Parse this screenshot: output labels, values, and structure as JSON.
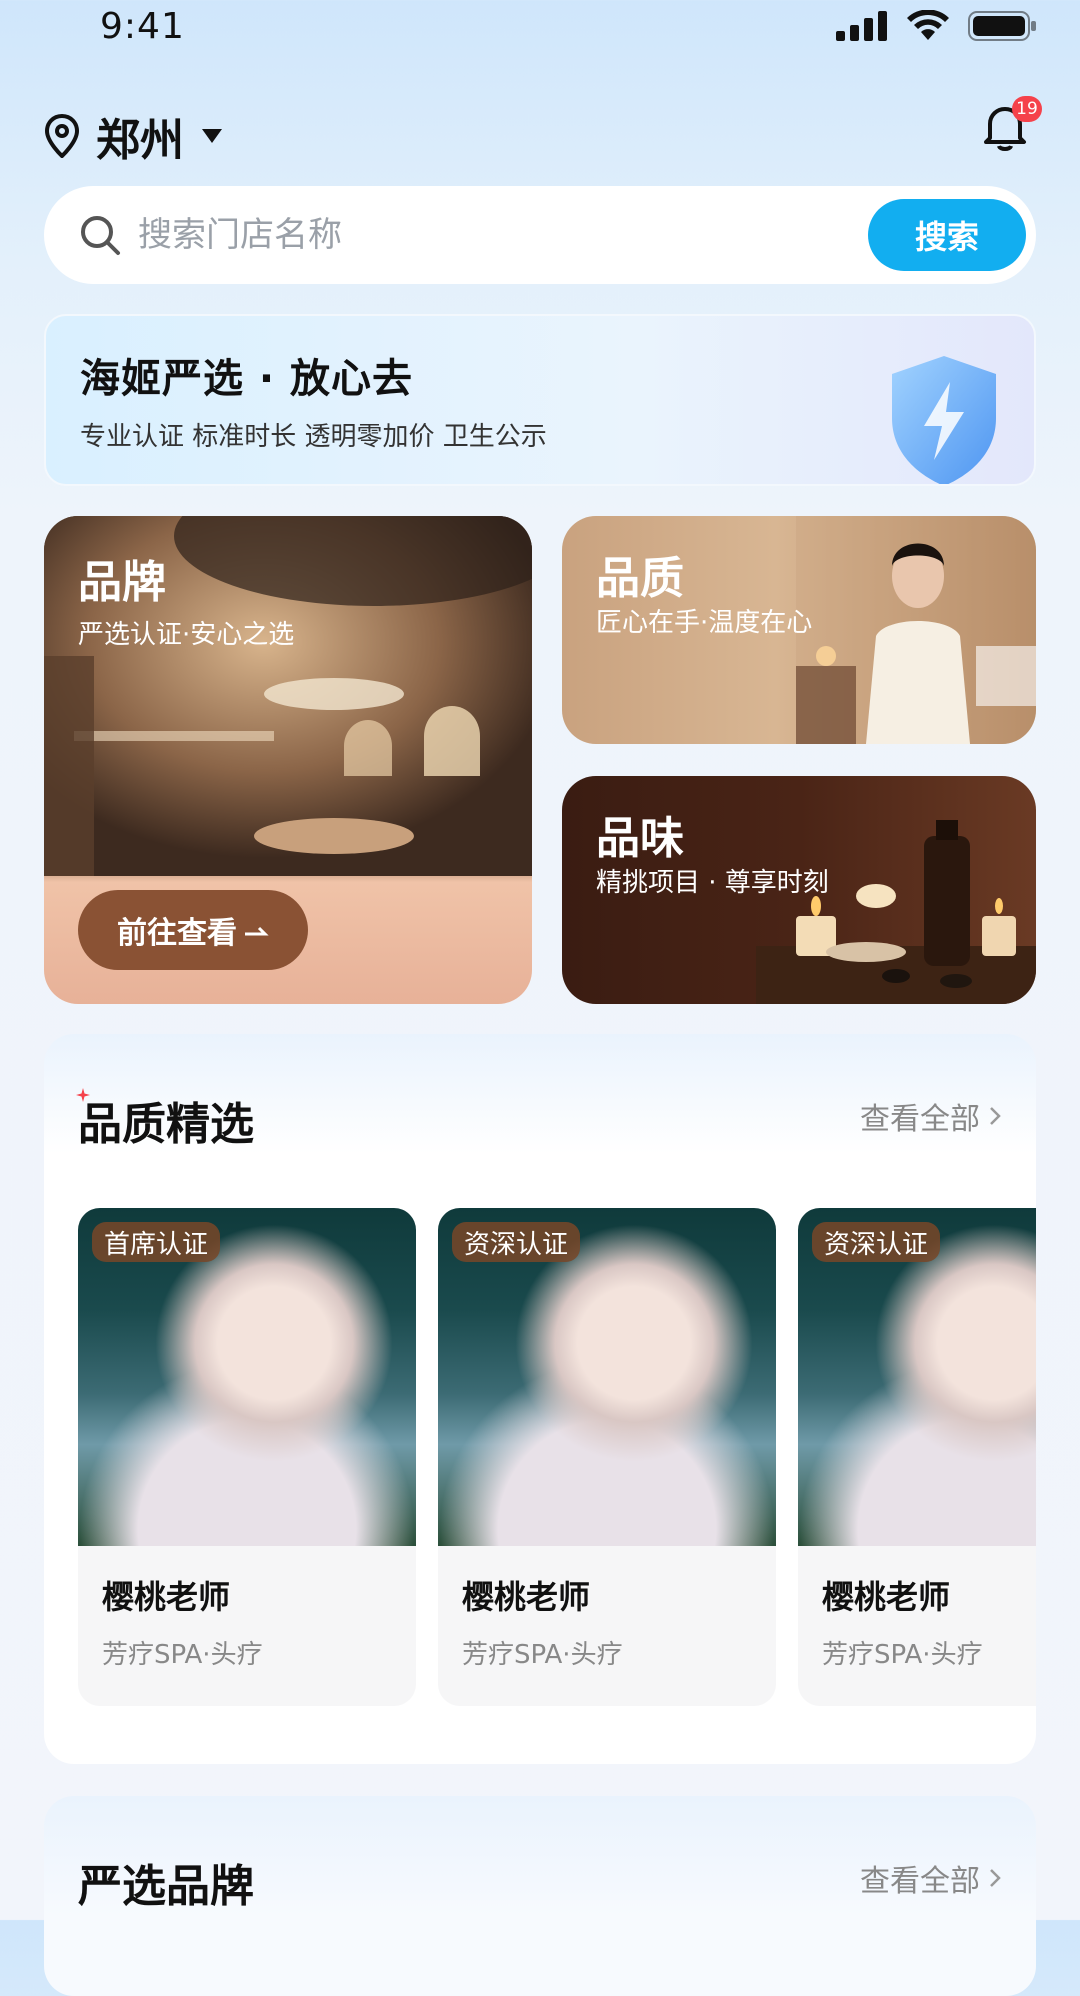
{
  "status_bar": {
    "time": "9:41"
  },
  "header": {
    "city": "郑州",
    "notification_count": "19"
  },
  "search": {
    "placeholder": "搜索门店名称",
    "button_label": "搜索"
  },
  "promo": {
    "title": "海姬严选 · 放心去",
    "subtitle": "专业认证 标准时长 透明零加价 卫生公示"
  },
  "features": {
    "brand": {
      "title": "品牌",
      "subtitle": "严选认证·安心之选",
      "button_label": "前往查看"
    },
    "quality": {
      "title": "品质",
      "subtitle": "匠心在手·温度在心"
    },
    "taste": {
      "title": "品味",
      "subtitle": "精挑项目 · 尊享时刻"
    }
  },
  "quality_section": {
    "title": "品质精选",
    "see_all": "查看全部",
    "therapists": [
      {
        "badge": "首席认证",
        "name": "樱桃老师",
        "tags": "芳疗SPA·头疗"
      },
      {
        "badge": "资深认证",
        "name": "樱桃老师",
        "tags": "芳疗SPA·头疗"
      },
      {
        "badge": "资深认证",
        "name": "樱桃老师",
        "tags": "芳疗SPA·头疗"
      }
    ]
  },
  "brand_section": {
    "title": "严选品牌",
    "see_all": "查看全部"
  },
  "colors": {
    "accent": "#12aef0",
    "badge_red": "#f5424b",
    "brown_button": "#8a5234"
  }
}
